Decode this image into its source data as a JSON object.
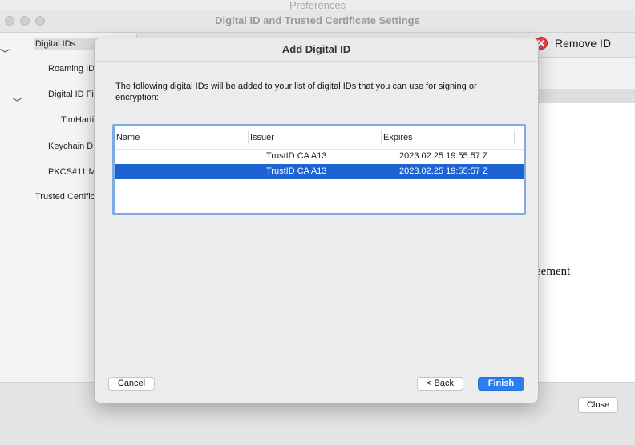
{
  "background_window": {
    "prefs_title": "Preferences",
    "title": "Digital ID and Trusted Certificate Settings",
    "sidebar": {
      "items": [
        {
          "label": "Digital IDs"
        },
        {
          "label": "Roaming ID"
        },
        {
          "label": "Digital ID Fi"
        },
        {
          "label": "TimHarti"
        },
        {
          "label": "Keychain Di"
        },
        {
          "label": "PKCS#11 M"
        },
        {
          "label": "Trusted Certific"
        }
      ]
    },
    "toolbar": {
      "remove_id_label": "Remove ID"
    },
    "pane_text": "eement",
    "close_label": "Close"
  },
  "dialog": {
    "title": "Add Digital ID",
    "description": "The following digital IDs will be added to your list of digital IDs that you can use for signing or encryption:",
    "columns": [
      "Name",
      "Issuer",
      "Expires"
    ],
    "rows": [
      {
        "name": "",
        "issuer": "TrustID CA A13",
        "expires": "2023.02.25 19:55:57 Z",
        "selected": false
      },
      {
        "name": "",
        "issuer": "TrustID CA A13",
        "expires": "2023.02.25 19:55:57 Z",
        "selected": true
      }
    ],
    "buttons": {
      "cancel": "Cancel",
      "back": "< Back",
      "finish": "Finish"
    }
  },
  "colors": {
    "selection": "#1e63d3",
    "primary_button": "#2a7ef1",
    "table_focus_ring": "#7faae8"
  }
}
